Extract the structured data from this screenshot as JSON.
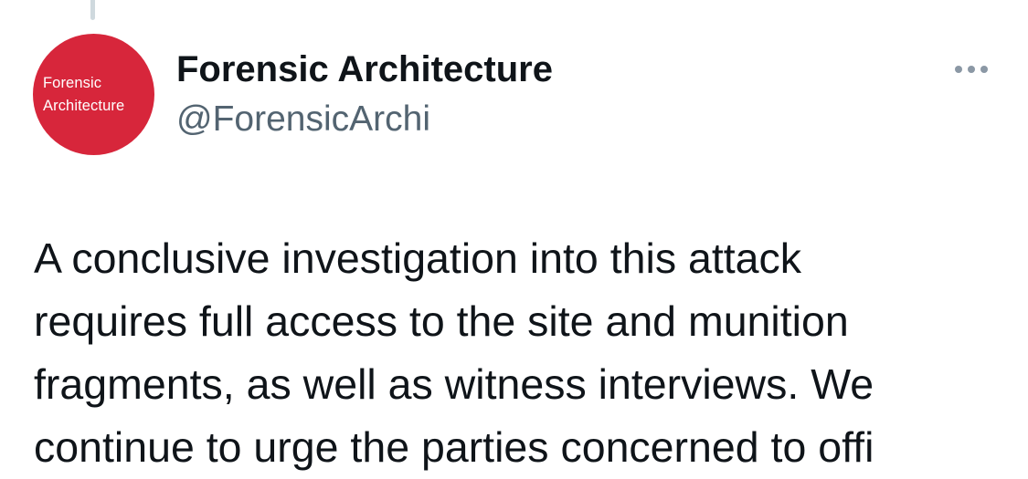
{
  "author": {
    "display_name": "Forensic Architecture",
    "handle": "@ForensicArchi",
    "avatar_text_line1": "Forensic",
    "avatar_text_line2": "Architecture",
    "avatar_color": "#d7263b"
  },
  "more_icon": "more-horizontal-icon",
  "tweet": {
    "lines": [
      "A conclusive investigation into this attack",
      "requires full access to the site and munition",
      "fragments, as well as witness interviews. We",
      "continue to urge the parties concerned to offi"
    ]
  },
  "colors": {
    "text_primary": "#0f1419",
    "text_secondary": "#536471",
    "thread_line": "#cfd9de"
  }
}
